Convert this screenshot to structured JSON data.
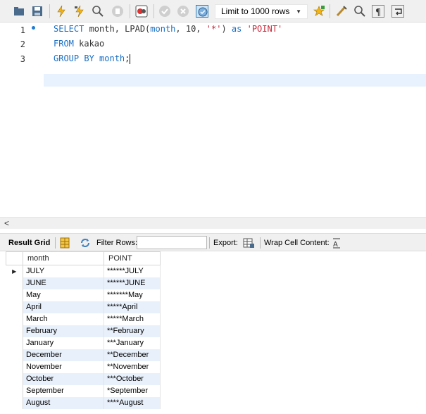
{
  "toolbar": {
    "limit_label": "Limit to 1000 rows",
    "icons": [
      "open-folder-icon",
      "save-icon",
      "execute-icon",
      "execute-current-icon",
      "explain-icon",
      "stop-icon",
      "toggle-error-icon",
      "commit-icon",
      "rollback-icon",
      "autocommit-icon",
      "bookmark-icon",
      "beautify-icon",
      "find-icon",
      "invisible-chars-icon",
      "wrap-icon"
    ]
  },
  "editor": {
    "line_numbers": [
      "1",
      "2",
      "3"
    ],
    "lines": [
      {
        "kw1": "SELECT",
        "p1": " month, LPAD(",
        "kw2": "month",
        "p2": ", 10, ",
        "s1": "'*'",
        "p3": ") ",
        "kw3": "as",
        "p4": " ",
        "s2": "'POINT'"
      },
      {
        "kw1": "FROM",
        "p1": " kakao"
      },
      {
        "kw1": "GROUP BY",
        "p1": " ",
        "kw2": "month",
        "p2": ";"
      }
    ]
  },
  "result_bar": {
    "tab_label": "Result Grid",
    "filter_label": "Filter Rows:",
    "filter_value": "",
    "export_label": "Export:",
    "wrap_label": "Wrap Cell Content:"
  },
  "grid": {
    "columns": [
      "month",
      "POINT"
    ],
    "rows": [
      [
        "JULY",
        "******JULY"
      ],
      [
        "JUNE",
        "******JUNE"
      ],
      [
        "May",
        "*******May"
      ],
      [
        "April",
        "*****April"
      ],
      [
        "March",
        "*****March"
      ],
      [
        "February",
        "**February"
      ],
      [
        "January",
        "***January"
      ],
      [
        "December",
        "**December"
      ],
      [
        "November",
        "**November"
      ],
      [
        "October",
        "***October"
      ],
      [
        "September",
        "*September"
      ],
      [
        "August",
        "****August"
      ]
    ]
  },
  "colors": {
    "keyword": "#1a6fc4",
    "string": "#c4283a",
    "row_alt": "#e8f0fb"
  }
}
